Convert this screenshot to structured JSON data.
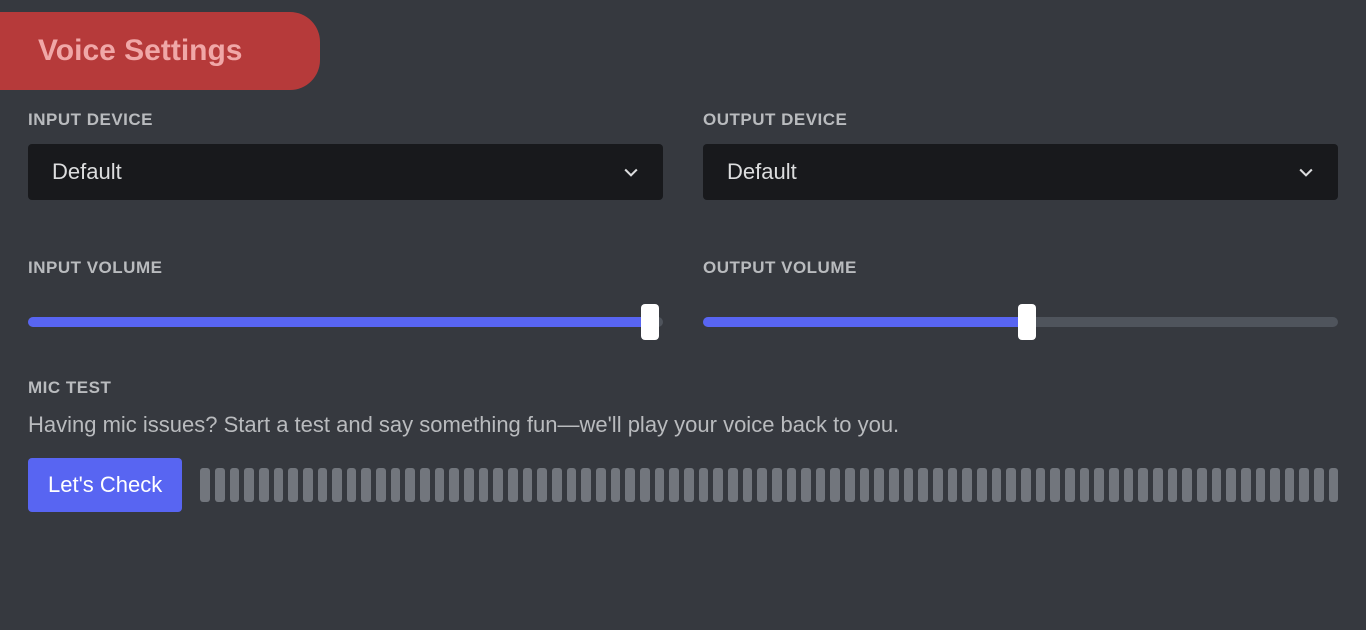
{
  "title": "Voice Settings",
  "input": {
    "device_label": "INPUT DEVICE",
    "device_selected": "Default",
    "volume_label": "INPUT VOLUME",
    "volume_percent": 98
  },
  "output": {
    "device_label": "OUTPUT DEVICE",
    "device_selected": "Default",
    "volume_label": "OUTPUT VOLUME",
    "volume_percent": 51
  },
  "mic_test": {
    "label": "MIC TEST",
    "desc": "Having mic issues? Start a test and say something fun—we'll play your voice back to you.",
    "button": "Let's Check",
    "meter_segments": 78
  },
  "colors": {
    "accent": "#5865f2",
    "title_bg": "#b63a3a",
    "title_fg": "#f0a7a7"
  }
}
